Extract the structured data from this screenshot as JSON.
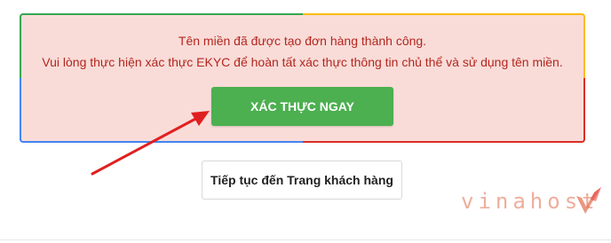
{
  "notice": {
    "line1": "Tên miền đã được tạo đơn hàng thành công.",
    "line2": "Vui lòng thực hiện xác thực EKYC để hoàn tất xác thực thông tin chủ thể và sử dụng tên miền.",
    "background": "#f9dcd8",
    "text_color": "#b3261e",
    "border_colors": [
      "#34a853",
      "#fbbc05",
      "#4285f4",
      "#d93025"
    ]
  },
  "verify_button": {
    "label": "XÁC THỰC NGAY",
    "color": "#4caf50"
  },
  "continue_button": {
    "label": "Tiếp tục đến Trang khách hàng"
  },
  "annotation": {
    "icon": "red-arrow-icon",
    "color": "#e02020"
  },
  "watermark": {
    "text": "vinahost",
    "icon": "vinahost-logo-icon",
    "color": "#e06c4a"
  }
}
